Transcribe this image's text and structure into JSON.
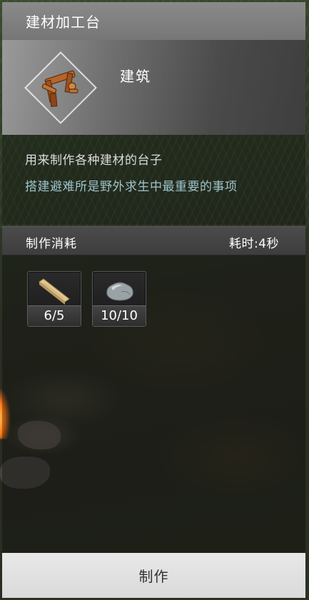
{
  "panel": {
    "title": "建材加工台"
  },
  "item": {
    "name": "建筑",
    "icon": "workbench-icon",
    "description": "用来制作各种建材的台子",
    "hint": "搭建避难所是野外求生中最重要的事项"
  },
  "cost": {
    "title": "制作消耗",
    "time": "耗时:4秒",
    "materials": [
      {
        "icon": "wood-plank-icon",
        "count": "6/5"
      },
      {
        "icon": "stone-icon",
        "count": "10/10"
      }
    ]
  },
  "actions": {
    "craft_label": "制作"
  },
  "colors": {
    "hint_text": "#9fc4cc",
    "title_bar": "#808080",
    "button_bg": "#e0e0e0"
  }
}
